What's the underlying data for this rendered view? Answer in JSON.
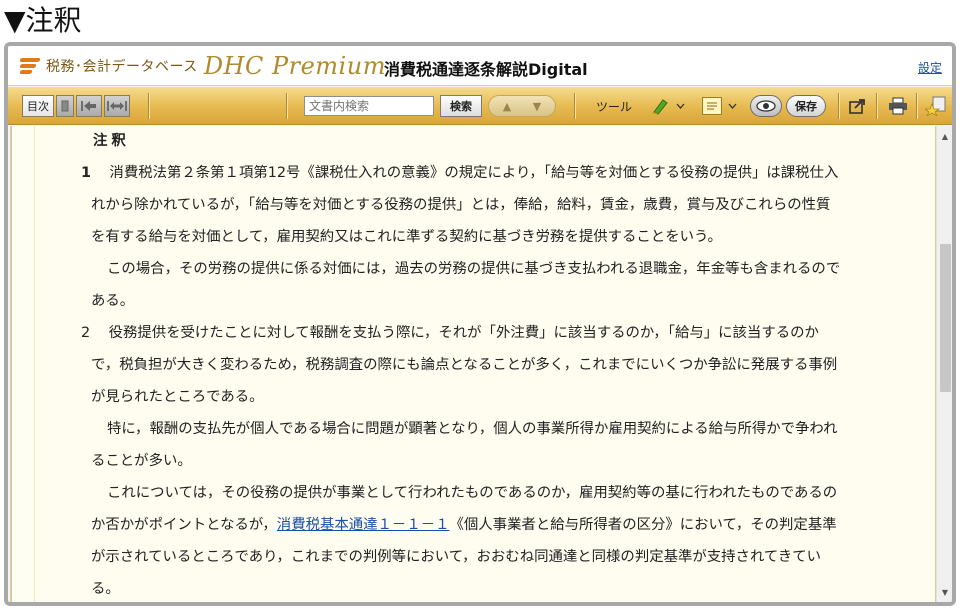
{
  "page": {
    "heading": "▼注釈"
  },
  "app": {
    "logo_jp": "税務･会計データベース",
    "logo_en": "DHC Premium",
    "doc_title": "消費税通達逐条解説Digital",
    "settings_label": "設定"
  },
  "toolbar": {
    "toc_label": "目次",
    "search_placeholder": "文書内検索",
    "search_label": "検索",
    "prev_symbol": "▲",
    "next_symbol": "▼",
    "tool_label": "ツール",
    "save_label": "保存"
  },
  "icons": {
    "sidebar_toggle": "sidebar-toggle-icon",
    "back": "back-arrow-icon",
    "expand": "expand-width-icon",
    "highlighter": "highlighter-icon",
    "memo": "memo-icon",
    "eye": "eye-icon",
    "share": "share-icon",
    "print": "print-icon",
    "bookmark": "bookmark-star-icon"
  },
  "content": {
    "section_title": "注釈",
    "note1": {
      "num": "1",
      "line1": "消費税法第２条第１項第12号《課税仕入れの意義》の規定により，「給与等を対価とする役務の提供」は課税仕入",
      "line2": "れから除かれているが，「給与等を対価とする役務の提供」とは，俸給，給料，賃金，歳費，賞与及びこれらの性質",
      "line3": "を有する給与を対価として，雇用契約又はこれに準ずる契約に基づき労務を提供することをいう。",
      "line4": "この場合，その労務の提供に係る対価には，過去の労務の提供に基づき支払われる退職金，年金等も含まれるので",
      "line5": "ある。"
    },
    "note2": {
      "num": "2",
      "line1": "役務提供を受けたことに対して報酬を支払う際に，それが「外注費」に該当するのか，「給与」に該当するのか",
      "line2": "で，税負担が大きく変わるため，税務調査の際にも論点となることが多く，これまでにいくつか争訟に発展する事例",
      "line3": "が見られたところである。",
      "line4": "特に，報酬の支払先が個人である場合に問題が顕著となり，個人の事業所得か雇用契約による給与所得かで争われ",
      "line5": "ることが多い。",
      "line6": "これについては，その役務の提供が事業として行われたものであるのか，雇用契約等の基に行われたものであるの",
      "line7_pre": "か否かがポイントとなるが，",
      "line7_link": "消費税基本通達１－１－１",
      "line7_post": "《個人事業者と給与所得者の区分》において，その判定基準",
      "line8": "が示されているところであり，これまでの判例等において，おおむね同通達と同様の判定基準が支持されてきてい",
      "line9": "る。"
    }
  },
  "scrollbar": {
    "up": "▲",
    "down": "▼",
    "position": 0.25
  },
  "colors": {
    "toolbar": "#e6b94f",
    "content_bg": "#fffdf0",
    "link": "#1a4fa8",
    "logo_orange": "#e07a1a"
  }
}
